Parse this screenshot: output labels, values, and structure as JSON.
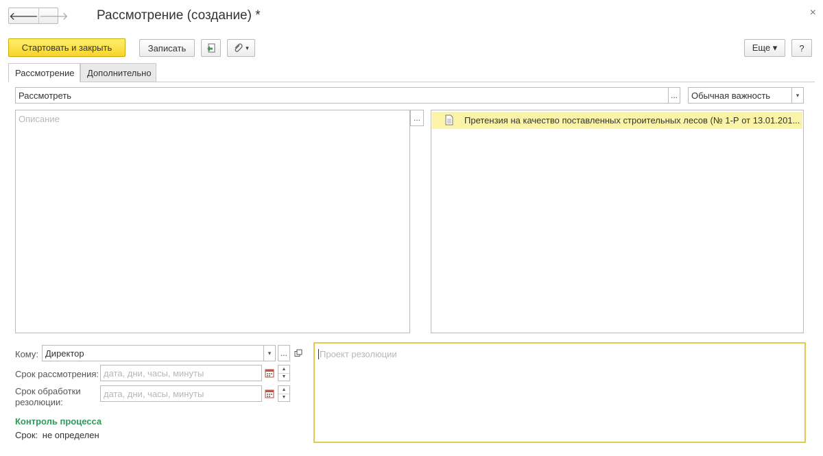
{
  "window": {
    "title": "Рассмотрение (создание) *",
    "back_glyph": "🡐",
    "forward_glyph": "🡒",
    "close_glyph": "×"
  },
  "toolbar": {
    "start_close_label": "Стартовать и закрыть",
    "save_label": "Записать",
    "more_label": "Еще ▾",
    "help_label": "?",
    "attach_dropdown_glyph": "▾"
  },
  "tabs": [
    {
      "label": "Рассмотрение",
      "active": true
    },
    {
      "label": "Дополнительно",
      "active": false
    }
  ],
  "form": {
    "subject_value": "Рассмотреть",
    "ellipsis": "...",
    "importance_value": "Обычная важность",
    "dropdown_glyph": "▾",
    "description_placeholder": "Описание",
    "attachment": "Претензия на качество поставленных строительных лесов (№ 1-Р от 13.01.201...",
    "to_label": "Кому:",
    "to_value": "Директор",
    "deadline_label": "Срок рассмотрения:",
    "deadline_placeholder": "дата, дни, часы, минуты",
    "resolution_deadline_label_1": "Срок обработки",
    "resolution_deadline_label_2": "резолюции:",
    "resolution_deadline_placeholder": "дата, дни, часы, минуты",
    "process_control_title": "Контроль процесса",
    "term_label": "Срок:",
    "term_value": "не определен",
    "resolution_placeholder": "Проект резолюции",
    "spin_up": "▲",
    "spin_down": "▼"
  },
  "colors": {
    "primary_button": "#f7d42a",
    "selected_row": "#fbf3a8",
    "active_field_border": "#e6c84a",
    "process_title": "#2e9a57"
  }
}
